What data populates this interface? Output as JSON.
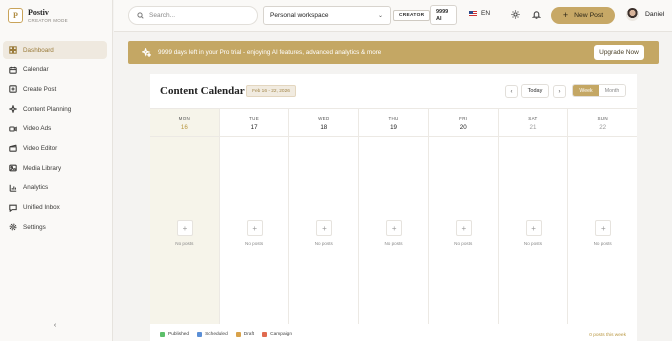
{
  "app": {
    "name": "Postiv",
    "mode": "CREATOR MODE",
    "logo_letter": "P"
  },
  "sidebar": {
    "items": [
      {
        "label": "Dashboard",
        "icon": "dashboard-icon",
        "active": true
      },
      {
        "label": "Calendar",
        "icon": "calendar-icon"
      },
      {
        "label": "Create Post",
        "icon": "plus-square-icon"
      },
      {
        "label": "Content Planning",
        "icon": "sparkle-icon"
      },
      {
        "label": "Video Ads",
        "icon": "video-icon"
      },
      {
        "label": "Video Editor",
        "icon": "clapperboard-icon"
      },
      {
        "label": "Media Library",
        "icon": "image-icon"
      },
      {
        "label": "Analytics",
        "icon": "bar-chart-icon"
      },
      {
        "label": "Unified Inbox",
        "icon": "message-icon"
      },
      {
        "label": "Settings",
        "icon": "gear-icon"
      }
    ],
    "collapse_glyph": "‹"
  },
  "topbar": {
    "search_placeholder": "Search...",
    "workspace": "Personal workspace",
    "role_badge": "CREATOR",
    "ai_credits_line1": "9999",
    "ai_credits_line2": "AI",
    "language": "EN",
    "new_post_label": "New Post",
    "user_name": "Daniel"
  },
  "banner": {
    "text": "9999 days left in your Pro trial - enjoying AI features, advanced analytics & more",
    "button": "Upgrade Now",
    "color": "#c4a764"
  },
  "calendar": {
    "title": "Content Calendar",
    "range": "Feb 16 - 22, 2026",
    "today_label": "Today",
    "views": [
      "Week",
      "Month"
    ],
    "active_view": "Week",
    "days": [
      {
        "name": "MON",
        "date": "16",
        "posts_text": "No posts",
        "today": true
      },
      {
        "name": "TUE",
        "date": "17",
        "posts_text": "No posts"
      },
      {
        "name": "WED",
        "date": "18",
        "posts_text": "No posts"
      },
      {
        "name": "THU",
        "date": "19",
        "posts_text": "No posts"
      },
      {
        "name": "FRI",
        "date": "20",
        "posts_text": "No posts"
      },
      {
        "name": "SAT",
        "date": "21",
        "posts_text": "No posts",
        "weekend": true
      },
      {
        "name": "SUN",
        "date": "22",
        "posts_text": "No posts",
        "weekend": true
      }
    ],
    "legend": [
      {
        "label": "Published",
        "color": "#5cbf6a"
      },
      {
        "label": "Scheduled",
        "color": "#5b8fd6"
      },
      {
        "label": "Draft",
        "color": "#d8a24a"
      },
      {
        "label": "Campaign",
        "color": "#e06a4f"
      }
    ],
    "week_count": "0 posts this week"
  },
  "colors": {
    "accent": "#c4a764",
    "accent_dark": "#b08d44"
  }
}
